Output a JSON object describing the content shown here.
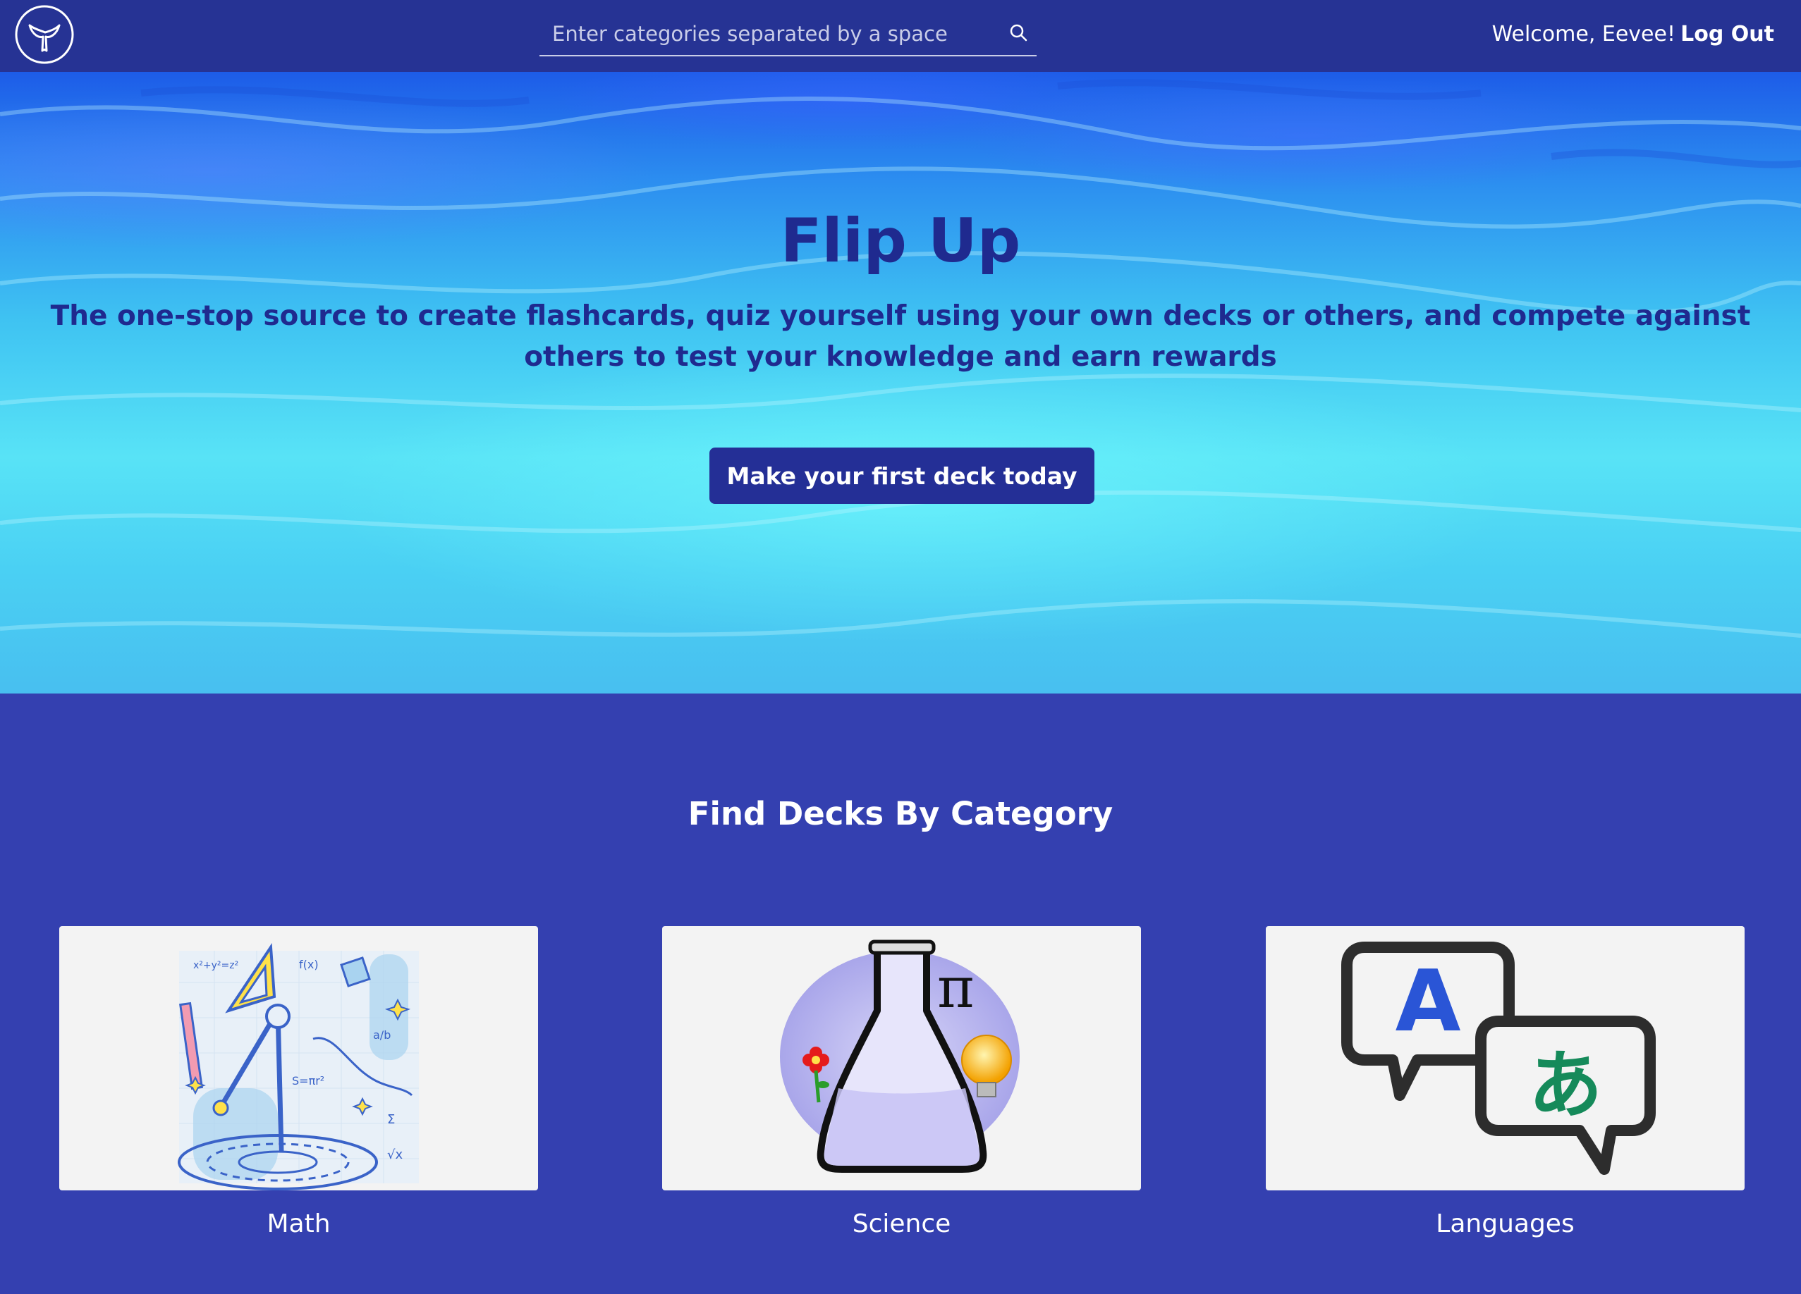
{
  "navbar": {
    "logo_icon": "whale-tail-logo-icon",
    "search": {
      "placeholder": "Enter categories separated by a space",
      "value": "",
      "icon": "search-icon"
    },
    "welcome_text": "Welcome, Eevee!",
    "logout_label": "Log Out"
  },
  "hero": {
    "title": "Flip Up",
    "subtitle": "The one-stop source to create flashcards, quiz yourself using your own decks or others, and compete against others to test your knowledge and earn rewards",
    "cta_label": "Make your first deck today"
  },
  "categories": {
    "heading": "Find Decks By Category",
    "items": [
      {
        "label": "Math",
        "icon": "math-illustration-icon"
      },
      {
        "label": "Science",
        "icon": "science-flask-icon"
      },
      {
        "label": "Languages",
        "icon": "translation-bubbles-icon"
      }
    ]
  },
  "colors": {
    "navbar": "#263394",
    "section_bg": "#3440b0",
    "title_text": "#1f2a8f",
    "button": "#242f96"
  }
}
